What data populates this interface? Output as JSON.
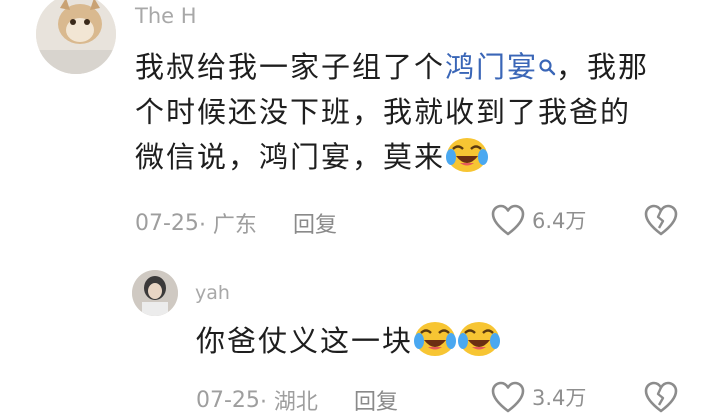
{
  "comments": [
    {
      "username": "The H",
      "text_before_link": "我叔给我一家子组了个",
      "link_text": "鸿门宴",
      "text_after_link_line1": "，我那",
      "text_line2": "个时候还没下班，我就收到了我爸的",
      "text_line3": "微信说，鸿门宴，莫来",
      "date": "07-25",
      "location": "· 广东",
      "reply_label": "回复",
      "like_count": "6.4万"
    },
    {
      "username": "yah",
      "text": "你爸仗义这一块",
      "date": "07-25",
      "location": "· 湖北",
      "reply_label": "回复",
      "like_count": "3.4万"
    }
  ],
  "icons": {
    "like": "heart-outline-icon",
    "dislike": "broken-heart-icon",
    "search": "search-icon",
    "emoji": "crying-laughing-emoji"
  },
  "colors": {
    "link": "#3a66b7",
    "meta": "#9e9e9e",
    "text": "#1e1e1e"
  }
}
